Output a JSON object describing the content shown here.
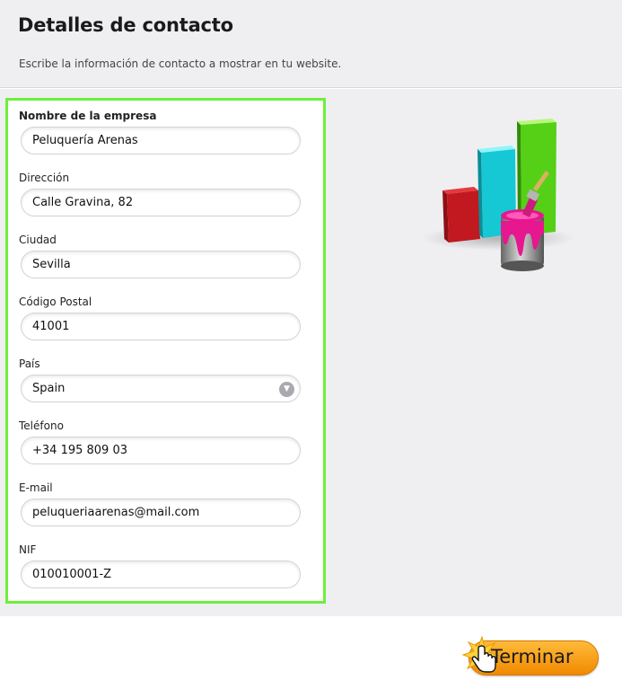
{
  "header": {
    "title": "Detalles de contacto",
    "subtitle": "Escribe la información de contacto a mostrar en tu website."
  },
  "form": {
    "fields": [
      {
        "label": "Nombre de la empresa",
        "value": "Peluquería Arenas"
      },
      {
        "label": "Dirección",
        "value": "Calle Gravina, 82"
      },
      {
        "label": "Ciudad",
        "value": "Sevilla"
      },
      {
        "label": "Código Postal",
        "value": "41001"
      },
      {
        "label": "País",
        "value": "Spain"
      },
      {
        "label": "Teléfono",
        "value": "+34 195 809 03"
      },
      {
        "label": "E-mail",
        "value": "peluqueriaarenas@mail.com"
      },
      {
        "label": "NIF",
        "value": "010010001-Z"
      }
    ]
  },
  "footer": {
    "finish_label": "Terminar"
  },
  "colors": {
    "highlight_border": "#6cf03a",
    "button_orange": "#f59a10"
  },
  "icons": {
    "select_arrow": "chevron-down-icon",
    "illustration": "bar-chart-paint-bucket-icon",
    "cursor": "hand-pointer-icon"
  }
}
